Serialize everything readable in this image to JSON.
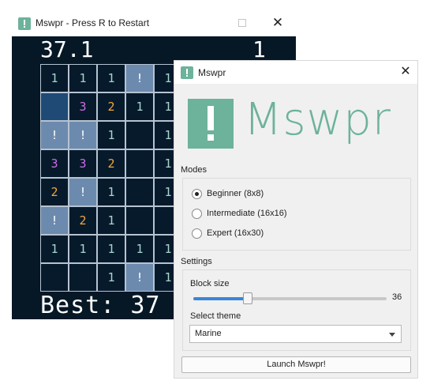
{
  "game": {
    "title": "Mswpr - Press R to Restart",
    "timer": "37.1",
    "mines_left": "1",
    "best": "Best: 37",
    "visible_cols": 5,
    "visible_rows": 8,
    "grid": [
      [
        {
          "s": "r",
          "v": "1"
        },
        {
          "s": "r",
          "v": "1"
        },
        {
          "s": "r",
          "v": "1"
        },
        {
          "s": "h",
          "v": "!"
        },
        {
          "s": "r",
          "v": "1"
        }
      ],
      [
        {
          "s": "p",
          "v": ""
        },
        {
          "s": "r",
          "v": "3"
        },
        {
          "s": "r",
          "v": "2"
        },
        {
          "s": "r",
          "v": "1"
        },
        {
          "s": "r",
          "v": "1"
        }
      ],
      [
        {
          "s": "h",
          "v": "!"
        },
        {
          "s": "h",
          "v": "!"
        },
        {
          "s": "r",
          "v": "1"
        },
        {
          "s": "r",
          "v": ""
        },
        {
          "s": "r",
          "v": "1"
        }
      ],
      [
        {
          "s": "r",
          "v": "3"
        },
        {
          "s": "r",
          "v": "3"
        },
        {
          "s": "r",
          "v": "2"
        },
        {
          "s": "r",
          "v": ""
        },
        {
          "s": "r",
          "v": "1"
        }
      ],
      [
        {
          "s": "r",
          "v": "2"
        },
        {
          "s": "h",
          "v": "!"
        },
        {
          "s": "r",
          "v": "1"
        },
        {
          "s": "r",
          "v": ""
        },
        {
          "s": "r",
          "v": "1"
        }
      ],
      [
        {
          "s": "h",
          "v": "!"
        },
        {
          "s": "r",
          "v": "2"
        },
        {
          "s": "r",
          "v": "1"
        },
        {
          "s": "r",
          "v": ""
        },
        {
          "s": "r",
          "v": ""
        }
      ],
      [
        {
          "s": "r",
          "v": "1"
        },
        {
          "s": "r",
          "v": "1"
        },
        {
          "s": "r",
          "v": "1"
        },
        {
          "s": "r",
          "v": "1"
        },
        {
          "s": "r",
          "v": "1"
        }
      ],
      [
        {
          "s": "r",
          "v": ""
        },
        {
          "s": "r",
          "v": ""
        },
        {
          "s": "r",
          "v": "1"
        },
        {
          "s": "h",
          "v": "!"
        },
        {
          "s": "r",
          "v": "1"
        }
      ]
    ]
  },
  "launcher": {
    "title": "Mswpr",
    "logo_text": "Mswpr",
    "modes_label": "Modes",
    "modes": [
      {
        "label": "Beginner (8x8)",
        "checked": true
      },
      {
        "label": "Intermediate (16x16)",
        "checked": false
      },
      {
        "label": "Expert (16x30)",
        "checked": false
      }
    ],
    "settings_label": "Settings",
    "block_size_label": "Block size",
    "block_size_value": "36",
    "block_size_fraction": 0.28,
    "theme_label": "Select theme",
    "theme_value": "Marine",
    "launch_label": "Launch Mswpr!"
  },
  "colors": {
    "brand": "#6db29a",
    "board_bg": "#061726",
    "hidden_cell": "#6c8aad",
    "slider_accent": "#3a86d6"
  },
  "icons": {
    "app_icon": "exclamation-square-icon",
    "close_icon": "close-icon",
    "maximize_icon": "maximize-icon",
    "dropdown_icon": "chevron-down-icon",
    "flag_icon": "exclamation-flag-icon"
  }
}
